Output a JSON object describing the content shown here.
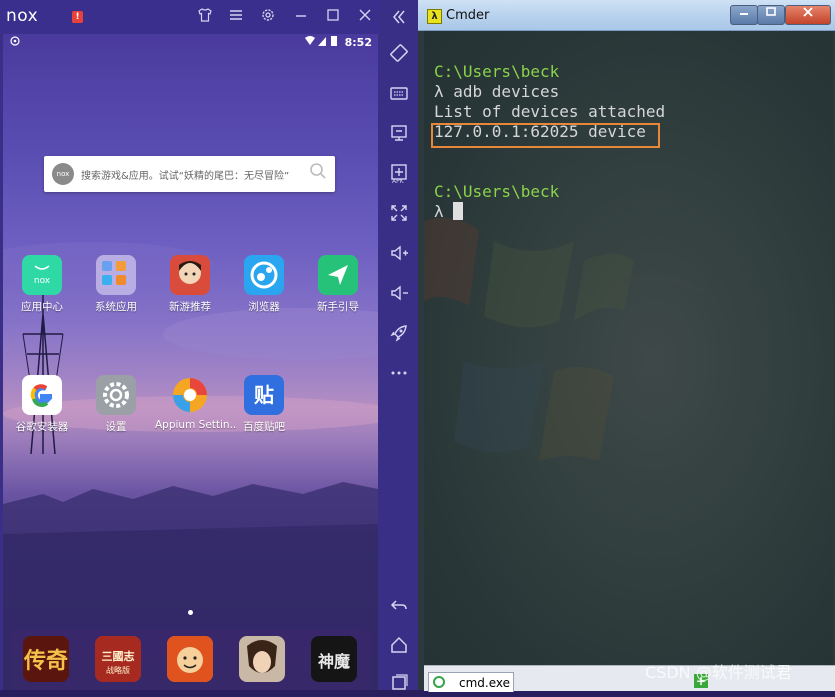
{
  "nox": {
    "logo": "nox",
    "alert_badge": "!",
    "status": {
      "time": "8:52"
    },
    "search": {
      "placeholder": "搜索游戏&应用。试试“妖精的尾巴：无尽冒险”"
    },
    "apps_row1": [
      {
        "label": "应用中心",
        "icon": "nox-app-center-icon",
        "color": "#2fd9a5"
      },
      {
        "label": "系统应用",
        "icon": "system-apps-folder-icon",
        "color": "#b9aee3"
      },
      {
        "label": "新游推荐",
        "icon": "new-games-icon",
        "color": "#d94b3a"
      },
      {
        "label": "浏览器",
        "icon": "browser-icon",
        "color": "#2aa6f0"
      },
      {
        "label": "新手引导",
        "icon": "guide-icon",
        "color": "#27c27a"
      }
    ],
    "apps_row2": [
      {
        "label": "谷歌安装器",
        "icon": "google-installer-icon",
        "color": "#ffffff"
      },
      {
        "label": "设置",
        "icon": "settings-icon",
        "color": "#9aa0a6"
      },
      {
        "label": "Appium Settin..",
        "icon": "appium-settings-icon",
        "color": "#f5a623"
      },
      {
        "label": "百度贴吧",
        "icon": "baidu-tieba-icon",
        "color": "#2f6fe0"
      }
    ],
    "dock": [
      {
        "label": "传奇",
        "icon": "legend-game-icon"
      },
      {
        "label": "三国志 战略版",
        "icon": "three-kingdoms-game-icon"
      },
      {
        "label": "",
        "icon": "monk-game-icon"
      },
      {
        "label": "",
        "icon": "hero-game-icon"
      },
      {
        "label": "神魔",
        "icon": "shenmo-game-icon"
      }
    ],
    "side_toolbar": [
      "rotate-icon",
      "keyboard-icon",
      "screen-icon",
      "apk-install-icon",
      "fullscreen-icon",
      "volume-up-icon",
      "volume-down-icon",
      "rocket-icon",
      "more-icon",
      "back-icon",
      "home-icon",
      "recent-icon"
    ],
    "apk_label": "APK"
  },
  "cmder": {
    "title": "Cmder",
    "lambda": "λ",
    "lines": [
      {
        "type": "path",
        "text": "C:\\Users\\beck"
      },
      {
        "type": "cmd",
        "text": "λ adb devices"
      },
      {
        "type": "cmd",
        "text": "List of devices attached"
      },
      {
        "type": "cmd",
        "text": "127.0.0.1:62025 device"
      },
      {
        "type": "path",
        "text": "C:\\Users\\beck"
      },
      {
        "type": "cmd",
        "text": "λ "
      }
    ],
    "tab_label": "cmd.exe",
    "accent": "#e8873a"
  },
  "watermark": "CSDN @软件测试君"
}
